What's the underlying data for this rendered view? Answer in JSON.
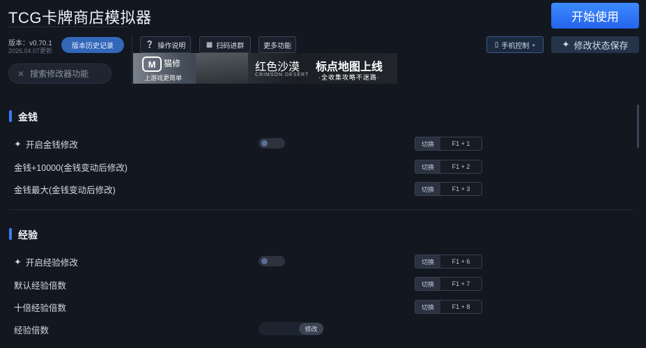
{
  "header": {
    "title": "TCG卡牌商店模拟器",
    "start_label": "开始使用",
    "version_label": "版本：v0.70.1",
    "version_date": "2026.04.07更新",
    "history_label": "版本历史记录",
    "help_label": "操作说明",
    "scan_label": "扫码进群",
    "more_label": "更多功能",
    "phone_label": "手机控制",
    "save_label": "修改状态保存",
    "search_placeholder": "搜索修改器功能"
  },
  "banner": {
    "brand": "猫修",
    "sub": "上游戏更简单",
    "game_title": "红色沙漠",
    "game_title_en": "CRIMSON DESERT",
    "headline": "标点地图上线",
    "tagline": "·全收集攻略不迷路·"
  },
  "toggle_label": "切换",
  "modify_label": "修改",
  "sections": [
    {
      "title": "金钱",
      "rows": [
        {
          "label": "开启金钱修改",
          "hotkey": "F1 + 1"
        },
        {
          "label": "金钱+10000(金钱变动后修改)",
          "hotkey": "F1 + 2"
        },
        {
          "label": "金钱最大(金钱变动后修改)",
          "hotkey": "F1 + 3"
        }
      ]
    },
    {
      "title": "经验",
      "rows": [
        {
          "label": "开启经验修改",
          "hotkey": "F1 + 6"
        },
        {
          "label": "默认经验倍数",
          "hotkey": "F1 + 7"
        },
        {
          "label": "十倍经验倍数",
          "hotkey": "F1 + 8"
        },
        {
          "label": "经验倍数"
        }
      ]
    }
  ],
  "icons": {
    "help": "question-circle-icon",
    "scan": "qr-code-icon",
    "phone": "phone-icon",
    "save": "sparkle-icon",
    "search": "close-x-icon",
    "row_enable": "sparkle-icon"
  },
  "colors": {
    "accent": "#2f6fee",
    "background": "#121720",
    "section_bar": "#3d7bf0"
  }
}
